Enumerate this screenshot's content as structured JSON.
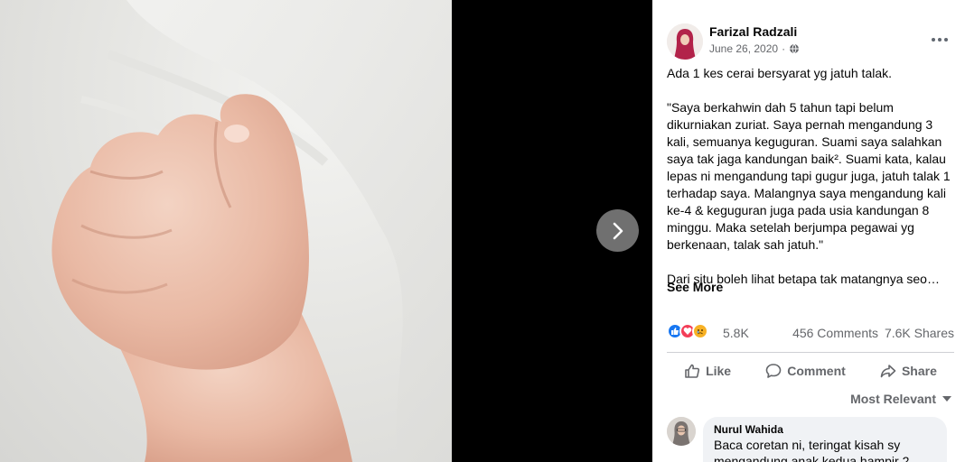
{
  "post": {
    "author": "Farizal Radzali",
    "date": "June 26, 2020",
    "privacy_icon": "globe-icon",
    "text": {
      "p1": "Ada 1 kes cerai bersyarat yg jatuh talak.",
      "p2": "\"Saya berkahwin dah 5 tahun tapi belum dikurniakan zuriat. Saya pernah mengandung 3 kali, semuanya keguguran. Suami saya salahkan saya tak jaga kandungan baik². Suami kata, kalau lepas ni mengandung tapi gugur juga, jatuh talak 1 terhadap saya. Malangnya saya mengandung kali ke-4 & keguguran juga pada usia kandungan 8 minggu. Maka setelah berjumpa pegawai yg berkenaan, talak sah jatuh.\"",
      "p3": "Dari situ boleh lihat betapa tak matangnya seo…"
    },
    "see_more": "See More"
  },
  "stats": {
    "reactions": [
      "like-icon",
      "love-icon",
      "sad-icon"
    ],
    "reaction_count": "5.8K",
    "comments": "456 Comments",
    "shares": "7.6K Shares"
  },
  "actions": {
    "like": "Like",
    "comment": "Comment",
    "share": "Share"
  },
  "filter": {
    "label": "Most Relevant"
  },
  "comment": {
    "author": "Nurul Wahida",
    "text": "Baca coretan ni, teringat kisah sy mengandung anak kedua hampir 2"
  },
  "colors": {
    "like_blue": "#1877f2",
    "love_red": "#f33e58",
    "sad_yellow": "#f7b125",
    "secondary_text": "#65676b"
  }
}
